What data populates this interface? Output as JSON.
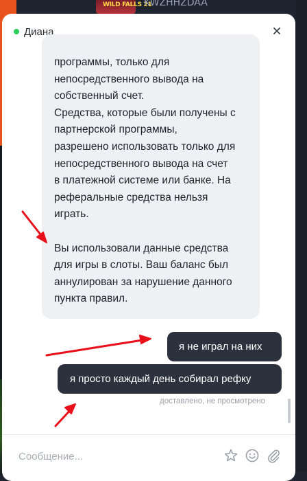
{
  "background": {
    "thumbnail_text": "WILD FALLS 21",
    "code_text": "KWZHHZDAA"
  },
  "chat": {
    "agent_name": "Диана",
    "online_status_color": "#2ecc5a",
    "close_icon": "close-icon",
    "incoming_message": {
      "paragraph_1": "программы, только для\nнепосредственного вывода на\nсобственный счет.\nСредства, которые были получены с\nпартнерской программы,\nразрешено использовать только для\nнепосредственного вывода на счет\nв платежной системе или банке. На\nреферальные средства нельзя\nиграть.",
      "paragraph_2": "Вы использовали данные средства\nдля игры в слоты. Ваш баланс был\nаннулирован за нарушение данного\nпункта правил."
    },
    "outgoing_messages": [
      "я не играл на них",
      "я просто каждый день собирал рефку"
    ],
    "delivery_status": "доставлено, не просмотрено",
    "composer": {
      "placeholder": "Сообщение...",
      "value": "",
      "icons": [
        "star-icon",
        "emoji-icon",
        "paperclip-icon"
      ]
    }
  },
  "annotations": {
    "arrow_color": "#e8101a",
    "arrow_count": 3
  }
}
